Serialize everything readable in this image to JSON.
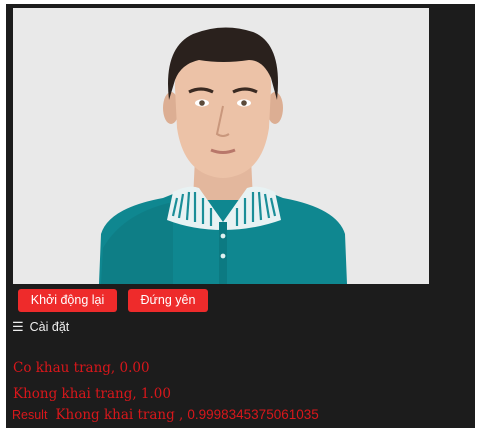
{
  "buttons": {
    "restart": "Khởi động lại",
    "stop": "Đứng yên"
  },
  "settings": {
    "label": "Cài đặt",
    "menu_icon": "hamburger-icon"
  },
  "predictions": [
    "Co khau trang, 0.00",
    "Khong khai trang, 1.00"
  ],
  "result": {
    "label": "Result",
    "class": "Khong khai trang ,",
    "score": "0.9998345375061035"
  },
  "colors": {
    "app_bg": "#1c1c1c",
    "button": "#ee2b2b",
    "prediction_text": "#d8171b"
  }
}
